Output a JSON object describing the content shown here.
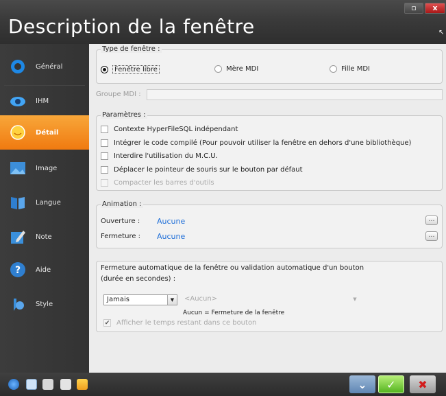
{
  "window": {
    "title": "Description de la fenêtre",
    "maximize_glyph": "▫",
    "close_glyph": "x",
    "cursor_glyph": "↖"
  },
  "sidebar": {
    "items": [
      {
        "label": "Général",
        "icon": "general-icon"
      },
      {
        "label": "IHM",
        "icon": "ihm-icon"
      },
      {
        "label": "Détail",
        "icon": "detail-icon",
        "active": true
      },
      {
        "label": "Image",
        "icon": "image-icon"
      },
      {
        "label": "Langue",
        "icon": "langue-icon"
      },
      {
        "label": "Note",
        "icon": "note-icon"
      },
      {
        "label": "Aide",
        "icon": "aide-icon"
      },
      {
        "label": "Style",
        "icon": "style-icon"
      }
    ]
  },
  "window_type": {
    "title": "Type de fenêtre :",
    "options": [
      "Fenêtre libre",
      "Mère MDI",
      "Fille MDI"
    ],
    "selected": "Fenêtre libre"
  },
  "mdi_group": {
    "label": "Groupe MDI :",
    "value": ""
  },
  "parameters": {
    "title": "Paramètres :",
    "items": [
      "Contexte HyperFileSQL indépendant",
      "Intégrer le code compilé (Pour pouvoir utiliser la fenêtre en dehors d'une bibliothèque)",
      "Interdire l'utilisation du M.C.U.",
      "Déplacer le pointeur de souris sur le bouton par défaut",
      "Compacter les barres d'outils"
    ]
  },
  "animation": {
    "title": "Animation :",
    "opening_label": "Ouverture :",
    "opening_value": "Aucune",
    "closing_label": "Fermeture :",
    "closing_value": "Aucune",
    "more_glyph": "…"
  },
  "auto_close": {
    "title_line1": "Fermeture automatique de la fenêtre ou validation automatique d'un bouton",
    "title_line2": "(durée en secondes) :",
    "duration_value": "Jamais",
    "button_value": "<Aucun>",
    "hint": "Aucun = Fermeture de la fenêtre",
    "show_remaining_label": "Afficher le temps restant dans ce bouton",
    "arrow_glyph": "▼",
    "check_glyph": "✔"
  },
  "bottom": {
    "validate_glyph": "✓",
    "cancel_glyph": "✖",
    "expand_glyph": "⌄"
  },
  "colors": {
    "accent": "#f28a1c",
    "link": "#1f6fd8"
  }
}
